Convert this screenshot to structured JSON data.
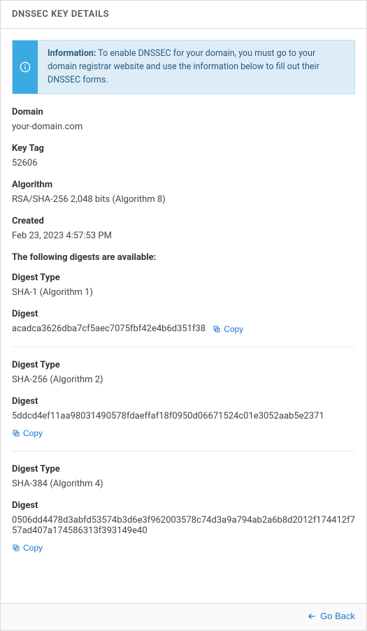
{
  "panel_title": "DNSSEC KEY DETAILS",
  "info": {
    "label": "Information:",
    "text": "To enable DNSSEC for your domain, you must go to your domain registrar website and use the information below to fill out their DNSSEC forms."
  },
  "fields": {
    "domain": {
      "label": "Domain",
      "value": "your-domain.com"
    },
    "key_tag": {
      "label": "Key Tag",
      "value": "52606"
    },
    "algorithm": {
      "label": "Algorithm",
      "value": "RSA/SHA-256 2,048 bits (Algorithm 8)"
    },
    "created": {
      "label": "Created",
      "value": "Feb 23, 2023 4:57:53 PM"
    }
  },
  "digests_header": "The following digests are available:",
  "digest_type_label": "Digest Type",
  "digest_label": "Digest",
  "copy_label": "Copy",
  "digests": [
    {
      "type": "SHA-1 (Algorithm 1)",
      "value": "acadca3626dba7cf5aec7075fbf42e4b6d351f38"
    },
    {
      "type": "SHA-256 (Algorithm 2)",
      "value": "5ddcd4ef11aa98031490578fdaeffaf18f0950d06671524c01e3052aab5e2371"
    },
    {
      "type": "SHA-384 (Algorithm 4)",
      "value": "0506dd4478d3abfd53574b3d6e3f962003578c74d3a9a794ab2a6b8d2012f174412f757ad407a174586313f393149e40"
    }
  ],
  "footer": {
    "go_back": "Go Back"
  }
}
